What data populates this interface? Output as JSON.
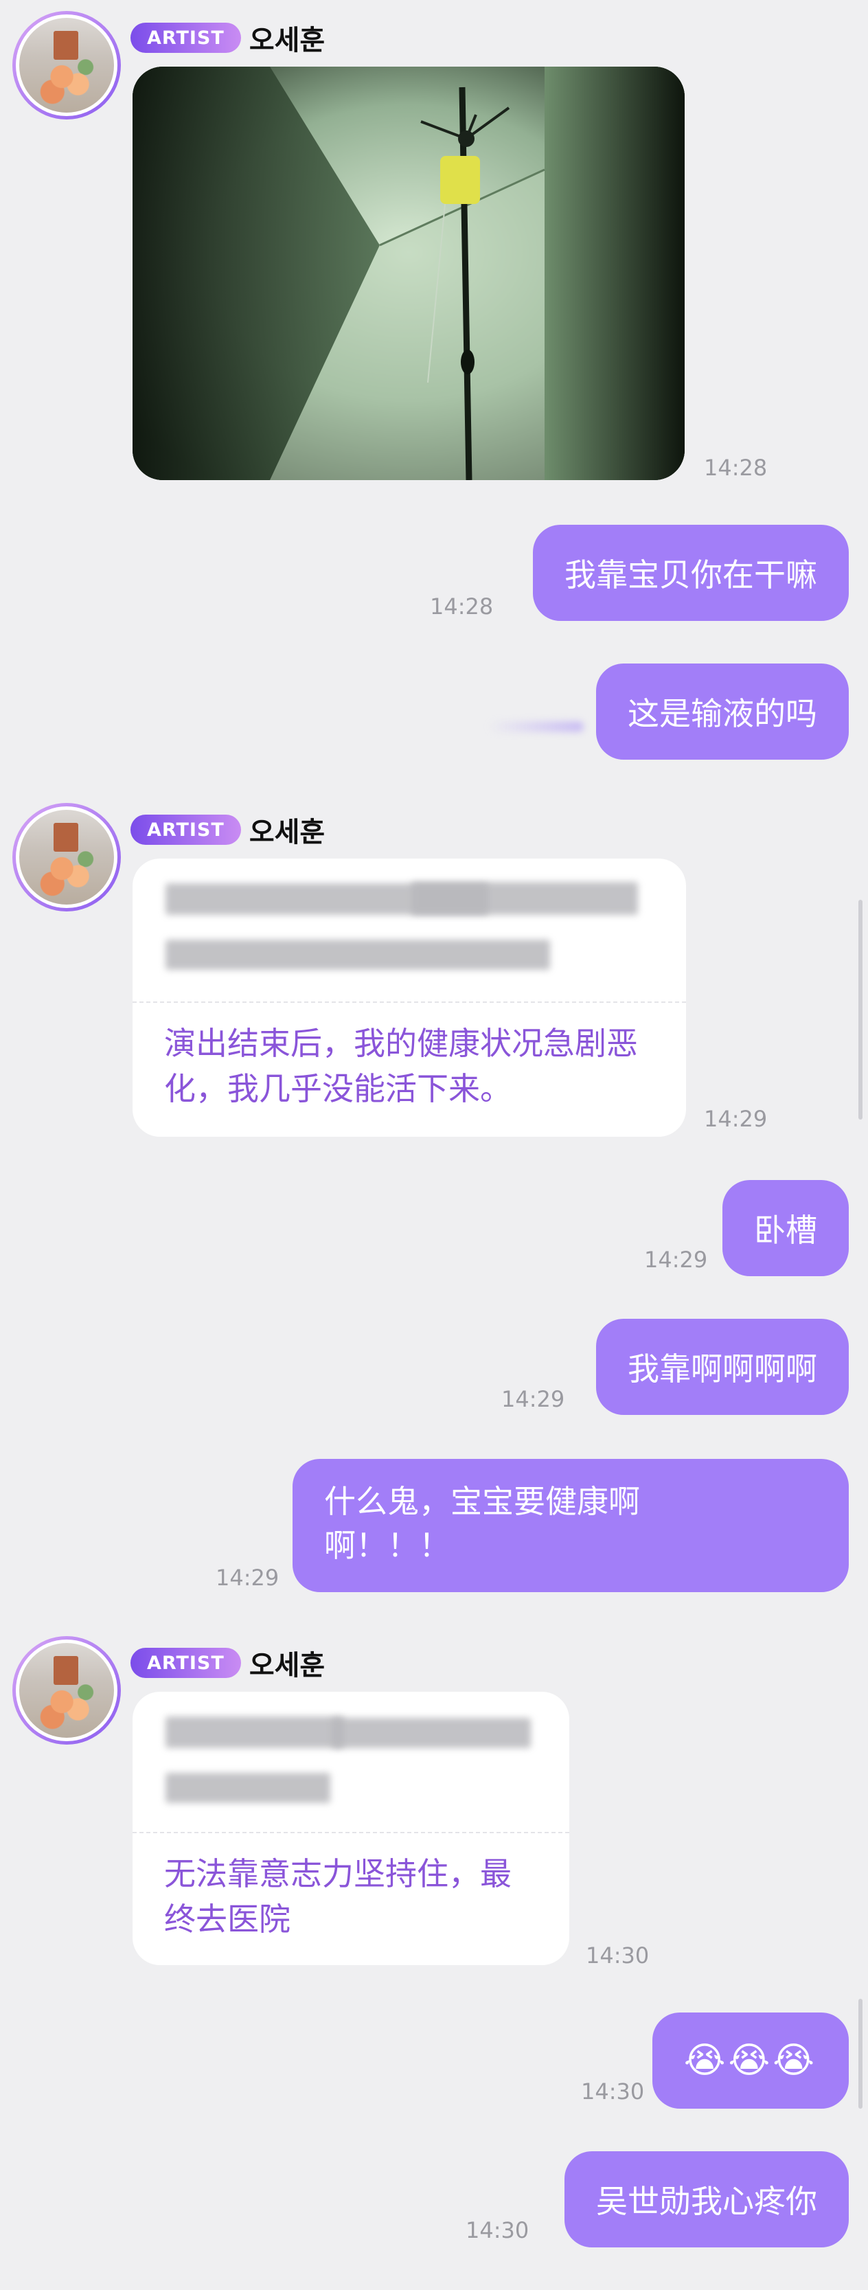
{
  "sender": {
    "badge": "ARTIST",
    "name": "오세훈"
  },
  "messages": {
    "m1": {
      "time": "14:28"
    },
    "m2": {
      "text": "我靠宝贝你在干嘛",
      "time": "14:28"
    },
    "m3": {
      "text": "这是输液的吗"
    },
    "m4": {
      "translation": "演出结束后，我的健康状况急剧恶化，我几乎没能活下来。",
      "time": "14:29"
    },
    "m5": {
      "text": "卧槽",
      "time": "14:29"
    },
    "m6": {
      "text": "我靠啊啊啊啊",
      "time": "14:29"
    },
    "m7": {
      "text": "什么鬼，宝宝要健康啊啊！！！",
      "time": "14:29"
    },
    "m8": {
      "translation": "无法靠意志力坚持住，最终去医院",
      "time": "14:30"
    },
    "m9": {
      "emoji": "😭😭😭",
      "time": "14:30"
    },
    "m10": {
      "text": "吴世勋我心疼你",
      "time": "14:30"
    }
  },
  "colors": {
    "background": "#efeff1",
    "outgoing_bubble": "#a27ef8",
    "translation_text": "#8a55d9",
    "badge_gradient_start": "#7b4dea",
    "badge_gradient_end": "#c98cf3"
  }
}
